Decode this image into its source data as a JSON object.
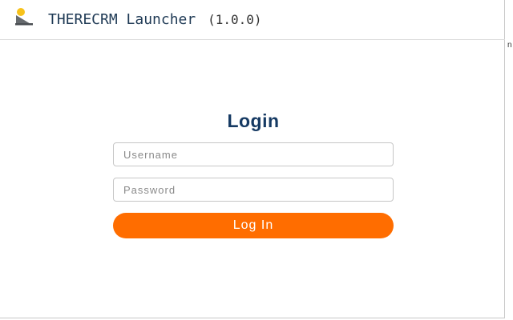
{
  "header": {
    "title": "THERECRM Launcher",
    "version": "(1.0.0)",
    "logo_icon": "therecrm-logo-icon"
  },
  "edge": {
    "mark": "n"
  },
  "login": {
    "title": "Login",
    "username_placeholder": "Username",
    "username_value": "",
    "password_placeholder": "Password",
    "password_value": "",
    "button_label": "Log In"
  },
  "colors": {
    "accent": "#ff6d00",
    "title_text": "#163a63",
    "header_text": "#1f3a55"
  }
}
